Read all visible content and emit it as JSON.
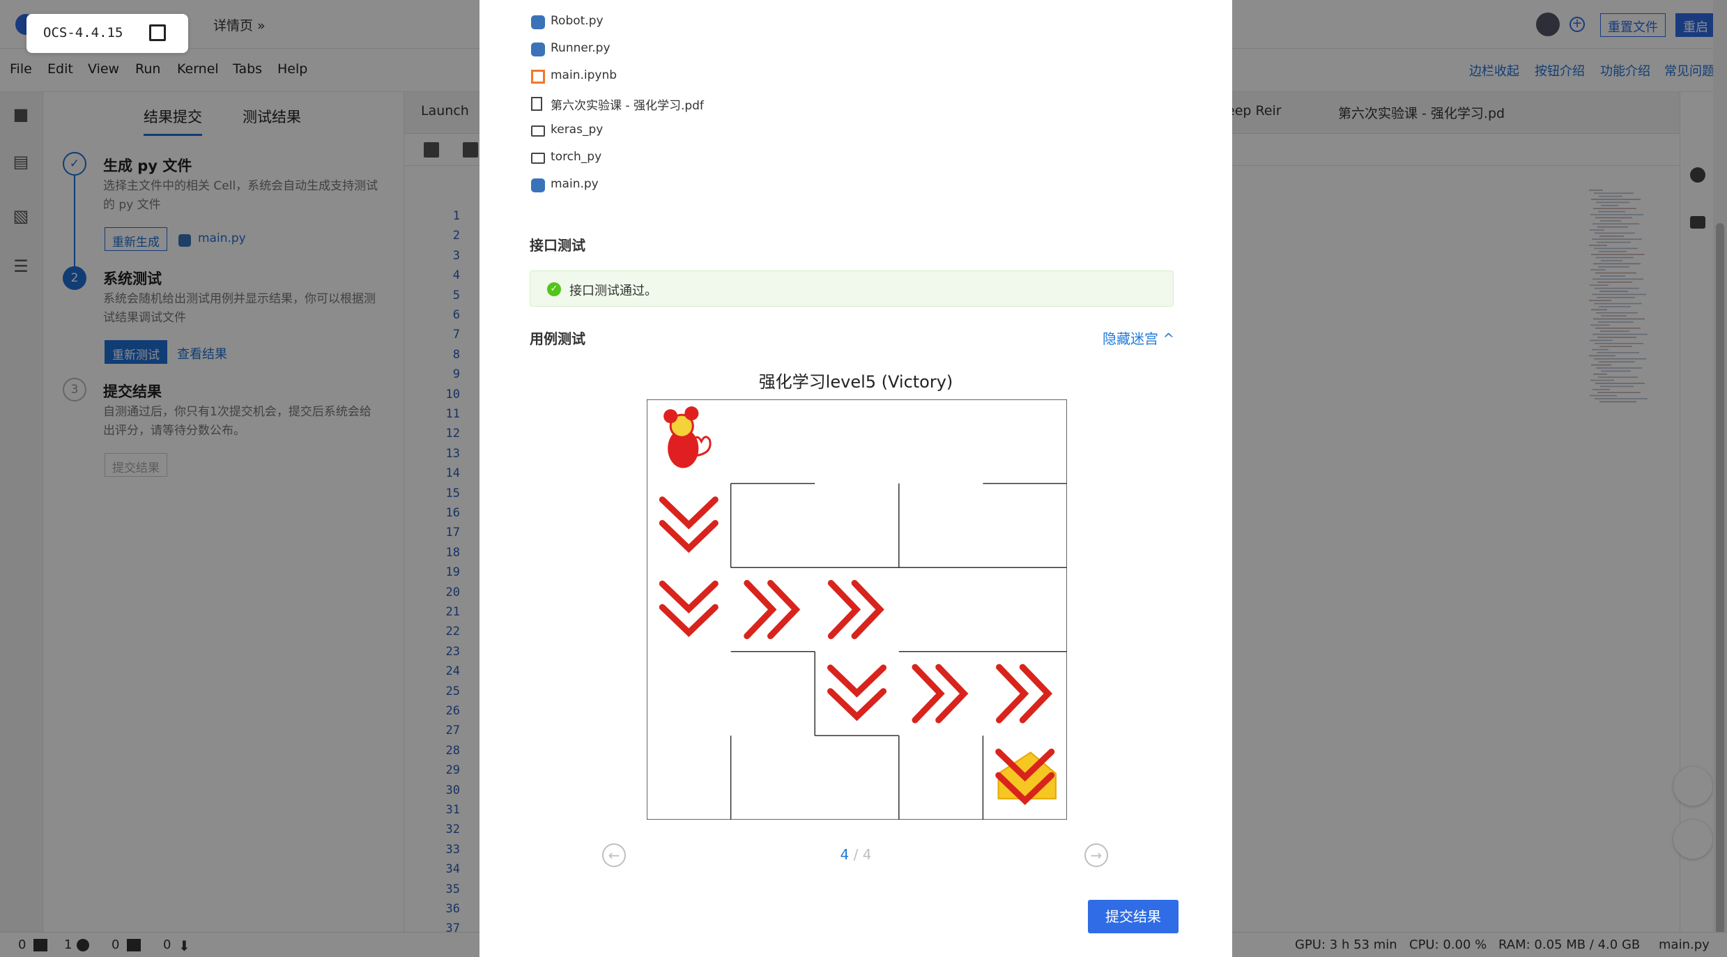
{
  "version_badge": {
    "text": "OCS-4.4.15"
  },
  "topbar": {
    "breadcrumb": "详情页 »",
    "buttons": {
      "reset_file": "重置文件",
      "restart": "重启"
    }
  },
  "menubar": {
    "items": [
      "File",
      "Edit",
      "View",
      "Run",
      "Kernel",
      "Tabs",
      "Help"
    ],
    "links": [
      "边栏收起",
      "按钮介绍",
      "功能介绍",
      "常见问题"
    ]
  },
  "side_panel": {
    "tabs": [
      "结果提交",
      "测试结果"
    ],
    "steps": [
      {
        "number": "",
        "title": "生成 py 文件",
        "desc": "选择主文件中的相关 Cell，系统会自动生成支持测试的 py 文件",
        "button": "重新生成",
        "file": "main.py"
      },
      {
        "number": "2",
        "title": "系统测试",
        "desc": "系统会随机给出测试用例并显示结果，你可以根据测试结果调试文件",
        "button": "重新测试",
        "link": "查看结果"
      },
      {
        "number": "3",
        "title": "提交结果",
        "desc": "自测通过后，你只有1次提交机会，提交后系统会给出评分，请等待分数公布。",
        "button": "提交结果"
      }
    ]
  },
  "editor": {
    "tabs": [
      "Launch",
      "eep Reir",
      "第六次实验课 - 强化学习.pd"
    ],
    "line_numbers": [
      "1",
      "2",
      "3",
      "4",
      "5",
      "6",
      "7",
      "8",
      "9",
      "10",
      "11",
      "12",
      "13",
      "14",
      "15",
      "16",
      "17",
      "18",
      "19",
      "20",
      "21",
      "22",
      "23",
      "24",
      "25",
      "26",
      "27",
      "28",
      "29",
      "30",
      "31",
      "32",
      "33",
      "34",
      "35",
      "36",
      "37"
    ]
  },
  "modal": {
    "files": [
      {
        "name": "Robot.py",
        "icon": "python-icon"
      },
      {
        "name": "Runner.py",
        "icon": "python-icon"
      },
      {
        "name": "main.ipynb",
        "icon": "notebook-icon"
      },
      {
        "name": "第六次实验课 - 强化学习.pdf",
        "icon": "file-icon"
      },
      {
        "name": "keras_py",
        "icon": "folder-icon"
      },
      {
        "name": "torch_py",
        "icon": "folder-icon"
      },
      {
        "name": "main.py",
        "icon": "python-icon"
      }
    ],
    "api_test": {
      "title": "接口测试",
      "message": "接口测试通过。"
    },
    "case_test": {
      "title": "用例测试",
      "toggle": "隐藏迷宫 ^"
    },
    "maze_title": "强化学习level5   (Victory)",
    "maze": {
      "size": 5,
      "robot": {
        "row": 0,
        "col": 0
      },
      "destination": {
        "row": 4,
        "col": 4
      },
      "path_moves": [
        {
          "row": 1,
          "col": 0,
          "dir": "down"
        },
        {
          "row": 2,
          "col": 0,
          "dir": "down"
        },
        {
          "row": 2,
          "col": 1,
          "dir": "right"
        },
        {
          "row": 2,
          "col": 2,
          "dir": "right"
        },
        {
          "row": 3,
          "col": 2,
          "dir": "down"
        },
        {
          "row": 3,
          "col": 3,
          "dir": "right"
        },
        {
          "row": 3,
          "col": 4,
          "dir": "right"
        },
        {
          "row": 4,
          "col": 4,
          "dir": "down"
        }
      ],
      "colors": {
        "arrow": "#d8241c",
        "robot": "#e02020",
        "cheese": "#f6c623",
        "wall": "#333333"
      }
    },
    "pager": {
      "current": "4",
      "separator": " / ",
      "total": "4"
    },
    "submit_button": "提交结果"
  },
  "status_bar": {
    "counters": [
      "0",
      "1",
      "0",
      "0"
    ],
    "gpu": "GPU: 3 h 53 min",
    "cpu": "CPU: 0.00 %",
    "ram": "RAM: 0.05 MB / 4.0 GB",
    "file": "main.py"
  }
}
